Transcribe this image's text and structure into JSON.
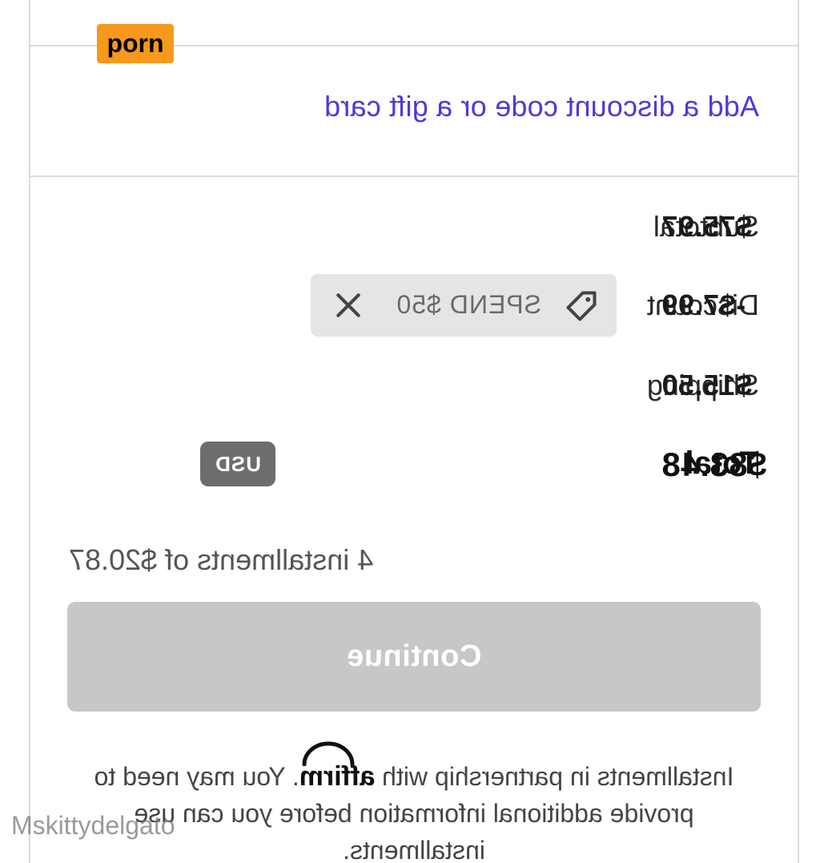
{
  "summary": {
    "discount_link": "Add a discount code or a gift card",
    "rows": [
      {
        "label": "Subtotal",
        "value": "$75.97"
      },
      {
        "label": "Discount",
        "value": "-$7.99"
      },
      {
        "label": "Shipping",
        "value": "$15.50"
      }
    ],
    "total": {
      "label": "Total",
      "currency": "USD",
      "value": "$83.48"
    }
  },
  "discount_chip": {
    "code": "SPEND $50",
    "icon": "tag-icon",
    "remove_icon": "close-icon"
  },
  "installments_text": "4 installments of $20.87",
  "continue_label": "Continue",
  "legal": {
    "prefix": "Installments in partnership with ",
    "logo_text": "affirm",
    "suffix": ". You may need to provide additional information before you can use installments."
  },
  "overlays": {
    "brand_tag": "porn",
    "watermark": "Mskittydelgato"
  },
  "colors": {
    "link": "#4f3ad6",
    "chip_bg": "#e5e5e5",
    "badge_bg": "#6d6d6d",
    "button_disabled": "#c7c7c7",
    "brand_tag_bg": "#f7991c"
  }
}
